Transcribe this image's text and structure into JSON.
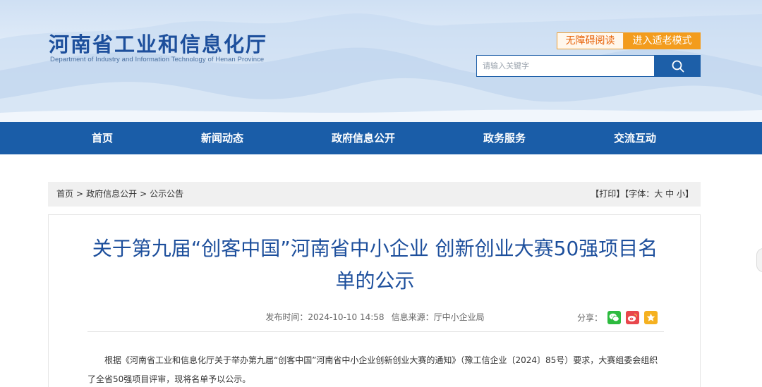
{
  "header": {
    "site_title": "河南省工业和信息化厅",
    "site_subtitle": "Department of Industry and Information Technology of Henan Province",
    "accessible_label": "无障碍阅读",
    "elder_mode_label": "进入适老模式",
    "search_placeholder": "请输入关键字"
  },
  "nav": {
    "items": [
      {
        "label": "首页"
      },
      {
        "label": "新闻动态"
      },
      {
        "label": "政府信息公开"
      },
      {
        "label": "政务服务"
      },
      {
        "label": "交流互动"
      }
    ]
  },
  "breadcrumb": {
    "items": [
      "首页",
      "政府信息公开",
      "公示公告"
    ],
    "separator": ">"
  },
  "tools": {
    "print": "【打印】",
    "font_prefix": "【字体：",
    "font_large": "大",
    "font_medium": "中",
    "font_small": "小",
    "font_suffix": "】"
  },
  "article": {
    "title": "关于第九届“创客中国”河南省中小企业 创新创业大赛50强项目名单的公示",
    "publish_time": "发布时间：2024-10-10 14:58",
    "source": "信息来源：厅中小企业局",
    "share_label": "分享：",
    "body": "根据《河南省工业和信息化厅关于举办第九届“创客中国”河南省中小企业创新创业大赛的通知》（豫工信企业〔2024〕85号）要求，大赛组委会组织了全省50强项目评审，现将名单予以公示。"
  },
  "colors": {
    "brand_blue": "#1a5da8",
    "title_blue": "#1d4f9c",
    "orange": "#f39c1d",
    "wechat_green": "#2dbb3f",
    "weibo_red": "#e8474c",
    "qzone_yellow": "#f5b120"
  },
  "icons": {
    "search": "search-icon",
    "wechat": "wechat-icon",
    "weibo": "weibo-icon",
    "qzone": "qzone-icon"
  }
}
